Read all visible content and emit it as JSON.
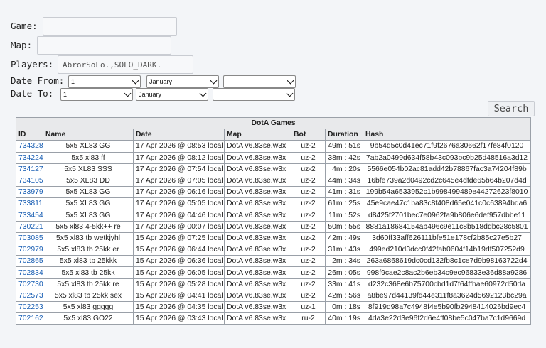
{
  "form": {
    "game_label": "Game:",
    "game_value": "",
    "map_label": "Map:",
    "map_value": "",
    "players_label": "Players:",
    "players_value": "AbrorSoLo.,SOLO_DARK.",
    "date_from_label": "Date From:",
    "date_to_label": "Date To:",
    "from_day": "1",
    "from_month": "January",
    "from_year": "",
    "to_day": "1",
    "to_month": "January",
    "to_year": "",
    "search_label": "Search"
  },
  "table": {
    "caption": "DotA Games",
    "headers": [
      "ID",
      "Name",
      "Date",
      "Map",
      "Bot",
      "Duration",
      "Hash"
    ],
    "rows": [
      [
        "734328",
        "5x5 XL83 GG",
        "17 Apr 2026 @ 08:53 local",
        "DotA v6.83se.w3x",
        "uz-2",
        "49m : 51s",
        "9b54d5c0d41ec71f9f2676a30662f17fe84f0120"
      ],
      [
        "734224",
        "5x5 xl83 ff",
        "17 Apr 2026 @ 08:12 local",
        "DotA v6.83se.w3x",
        "uz-2",
        "38m : 42s",
        "7ab2a0499d634f58b43c093bc9b25d48516a3d12"
      ],
      [
        "734127",
        "5x5 XL83 SSS",
        "17 Apr 2026 @ 07:54 local",
        "DotA v6.83se.w3x",
        "uz-2",
        "4m : 20s",
        "5566e054b02ac81add42b78867fac3a74204f89b"
      ],
      [
        "734105",
        "5x5 XL83 DD",
        "17 Apr 2026 @ 07:05 local",
        "DotA v6.83se.w3x",
        "uz-2",
        "44m : 34s",
        "16bfe739a2d0492cd2c645e4dfde65b64b207d4d"
      ],
      [
        "733979",
        "5x5 XL83 GG",
        "17 Apr 2026 @ 06:16 local",
        "DotA v6.83se.w3x",
        "uz-2",
        "41m : 31s",
        "199b54a6533952c1b998499489e44272623f8010"
      ],
      [
        "733811",
        "5x5 XL83 GG",
        "17 Apr 2026 @ 05:05 local",
        "DotA v6.83se.w3x",
        "uz-2",
        "61m : 25s",
        "45e9cae47c1ba83c8f408d65e041c0c63894bda6"
      ],
      [
        "733454",
        "5x5 XL83 GG",
        "17 Apr 2026 @ 04:46 local",
        "DotA v6.83se.w3x",
        "uz-2",
        "11m : 52s",
        "d8425f2701bec7e0962fa9b806e6def957dbbe11"
      ],
      [
        "730221",
        "5x5 xl83 4-5kk++ re",
        "17 Apr 2026 @ 00:07 local",
        "DotA v6.83se.w3x",
        "uz-2",
        "50m : 55s",
        "8881a18684154ab496c9e11c8b518ddbc28c5801"
      ],
      [
        "703085",
        "5x5 xl83 tb wetkjyhl",
        "15 Apr 2026 @ 07:25 local",
        "DotA v6.83se.w3x",
        "uz-2",
        "42m : 49s",
        "3d60ff33aff626111bfe51e178cf2b85c27e5b27"
      ],
      [
        "702979",
        "5x5 xl83 tb 25kk er",
        "15 Apr 2026 @ 06:44 local",
        "DotA v6.83se.w3x",
        "uz-2",
        "31m : 43s",
        "499ed210d3dcc0f42fab0604f14b19df507252d9"
      ],
      [
        "702865",
        "5x5 xl83 tb 25kkk",
        "15 Apr 2026 @ 06:36 local",
        "DotA v6.83se.w3x",
        "uz-2",
        "2m : 34s",
        "263a6868619dc0cd132fb8c1ce7d9b98163722d4"
      ],
      [
        "702834",
        "5x5 xl83 tb 25kk",
        "15 Apr 2026 @ 06:05 local",
        "DotA v6.83se.w3x",
        "uz-2",
        "26m : 05s",
        "998f9cae2c8ac2b6eb34c9ec96833e36d88a9286"
      ],
      [
        "702730",
        "5x5 xl83 tb 25kk re",
        "15 Apr 2026 @ 05:28 local",
        "DotA v6.83se.w3x",
        "uz-2",
        "33m : 41s",
        "d232c368e6b75700cbd1d7f64ffbae60972d50da"
      ],
      [
        "702573",
        "5x5 xl83 tb 25kk sex",
        "15 Apr 2026 @ 04:41 local",
        "DotA v6.83se.w3x",
        "uz-2",
        "42m : 56s",
        "a8be97d44139fd44e311f8a3624d5692123bc29a"
      ],
      [
        "702253",
        "5x5 xl83 ggggg",
        "15 Apr 2026 @ 04:35 local",
        "DotA v6.83se.w3x",
        "uz-1",
        "0m : 18s",
        "8f919d98a7c4948f4e5b90fb2948414026bd9ec4"
      ],
      [
        "702162",
        "5x5 xl83 GO22",
        "15 Apr 2026 @ 03:43 local",
        "DotA v6.83se.w3x",
        "ru-2",
        "40m : 19s",
        "4da3e22d3e96f2d6e4ff08be5c047ba7c1d9669d"
      ]
    ]
  }
}
